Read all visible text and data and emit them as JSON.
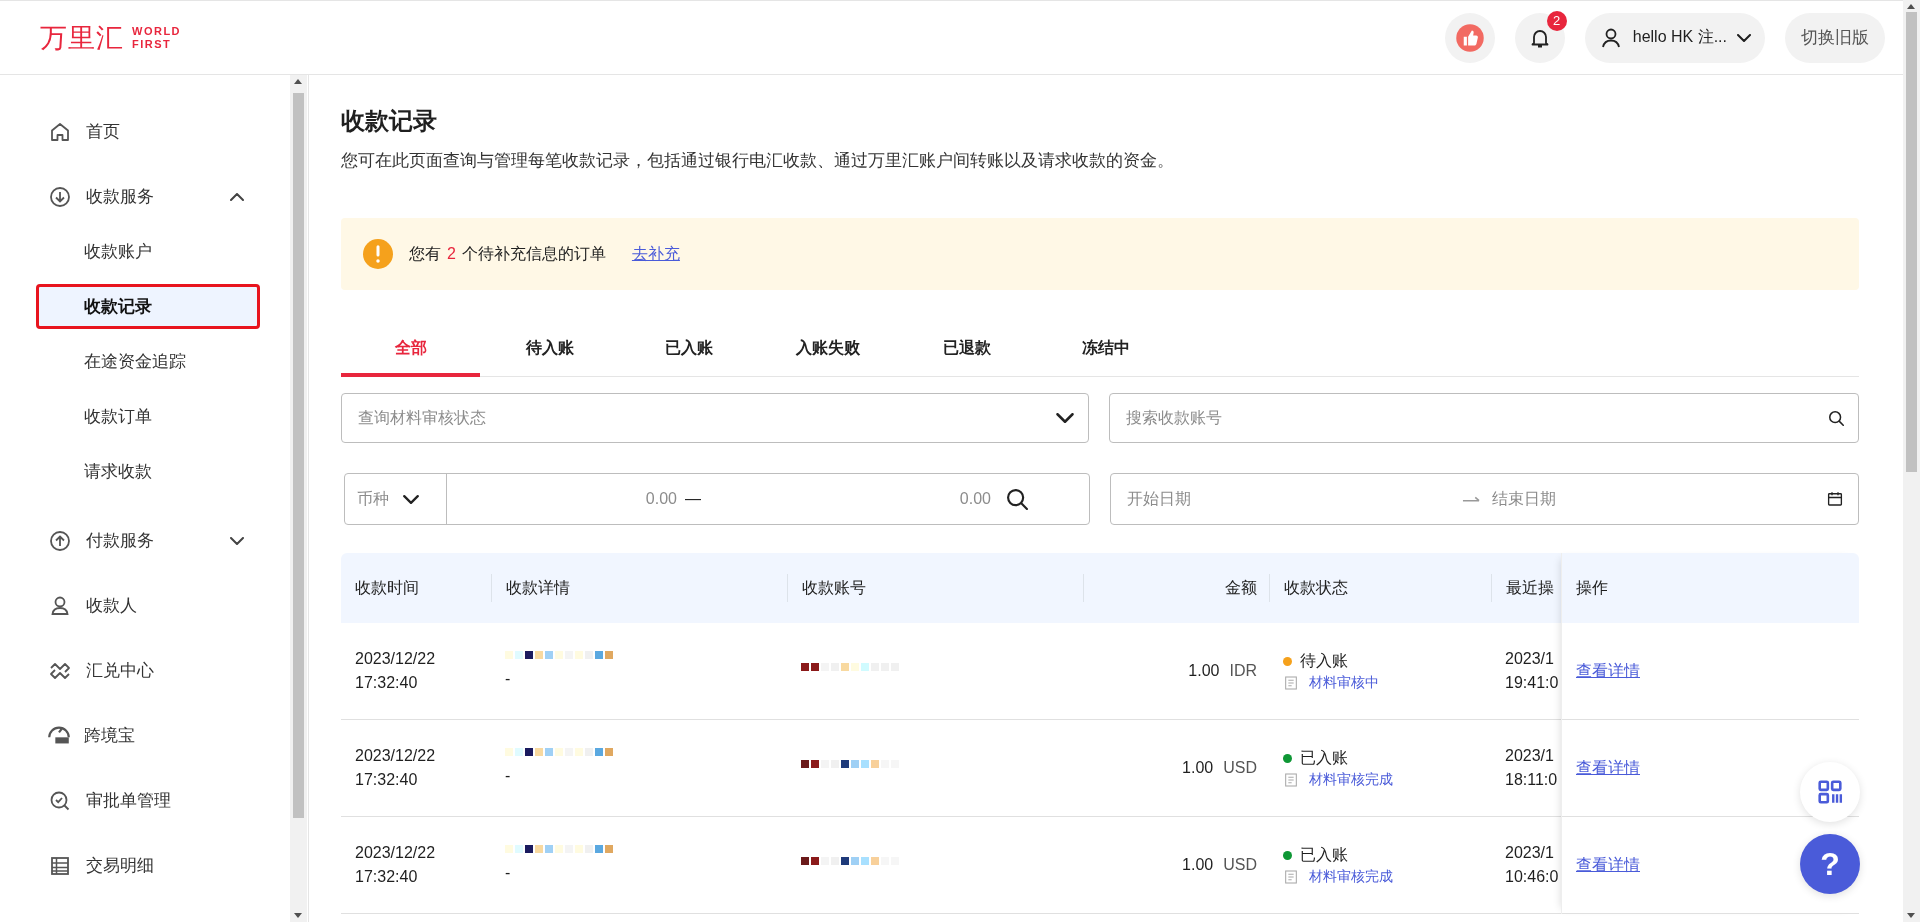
{
  "header": {
    "logo_cn": "万里汇",
    "logo_en": [
      "WORLD",
      "FIRST"
    ],
    "notification_count": "2",
    "user": "hello HK 注...",
    "switch_button": "切换旧版"
  },
  "sidebar": {
    "items": [
      {
        "label": "首页"
      },
      {
        "label": "收款服务",
        "expanded": true,
        "children": [
          {
            "label": "收款账户",
            "selected": false
          },
          {
            "label": "收款记录",
            "selected": true
          },
          {
            "label": "在途资金追踪",
            "selected": false
          },
          {
            "label": "收款订单",
            "selected": false
          },
          {
            "label": "请求收款",
            "selected": false
          }
        ]
      },
      {
        "label": "付款服务",
        "expanded": false
      },
      {
        "label": "收款人"
      },
      {
        "label": "汇兑中心"
      },
      {
        "label": "跨境宝"
      },
      {
        "label": "审批单管理"
      },
      {
        "label": "交易明细"
      }
    ]
  },
  "page": {
    "title": "收款记录",
    "description": "您可在此页面查询与管理每笔收款记录，包括通过银行电汇收款、通过万里汇账户间转账以及请求收款的资金。",
    "alert": {
      "prefix": "您有",
      "count": "2",
      "suffix": "个待补充信息的订单",
      "link": "去补充"
    },
    "tabs": [
      {
        "label": "全部",
        "selected": true
      },
      {
        "label": "待入账",
        "selected": false
      },
      {
        "label": "已入账",
        "selected": false
      },
      {
        "label": "入账失败",
        "selected": false
      },
      {
        "label": "已退款",
        "selected": false
      },
      {
        "label": "冻结中",
        "selected": false
      }
    ],
    "filters": {
      "review_status": {
        "placeholder": "查询材料审核状态"
      },
      "account_search": {
        "placeholder": "搜索收款账号"
      },
      "currency": {
        "placeholder": "币种"
      },
      "amount_min": {
        "placeholder": "0.00"
      },
      "amount_separator": "—",
      "amount_max": {
        "placeholder": "0.00"
      },
      "start_date": {
        "placeholder": "开始日期"
      },
      "end_date": {
        "placeholder": "结束日期"
      }
    }
  },
  "table": {
    "columns": [
      "收款时间",
      "收款详情",
      "收款账号",
      "金额",
      "收款状态",
      "最近操",
      "操作"
    ],
    "rows": [
      {
        "date": "2023/12/22",
        "time": "17:32:40",
        "details_line_2": "-",
        "amount": "1.00",
        "currency": "IDR",
        "status": {
          "label": "待入账",
          "color": "#f5a11c"
        },
        "review": "材料审核中",
        "recent_date": "2023/1",
        "recent_time": "19:41:0",
        "action": "查看详情"
      },
      {
        "date": "2023/12/22",
        "time": "17:32:40",
        "details_line_2": "-",
        "amount": "1.00",
        "currency": "USD",
        "status": {
          "label": "已入账",
          "color": "#0e9735"
        },
        "review": "材料审核完成",
        "recent_date": "2023/1",
        "recent_time": "18:11:0",
        "action": "查看详情"
      },
      {
        "date": "2023/12/22",
        "time": "17:32:40",
        "details_line_2": "-",
        "amount": "1.00",
        "currency": "USD",
        "status": {
          "label": "已入账",
          "color": "#0e9735"
        },
        "review": "材料审核完成",
        "recent_date": "2023/1",
        "recent_time": "10:46:0",
        "action": "查看详情"
      }
    ]
  },
  "help_button": "?"
}
